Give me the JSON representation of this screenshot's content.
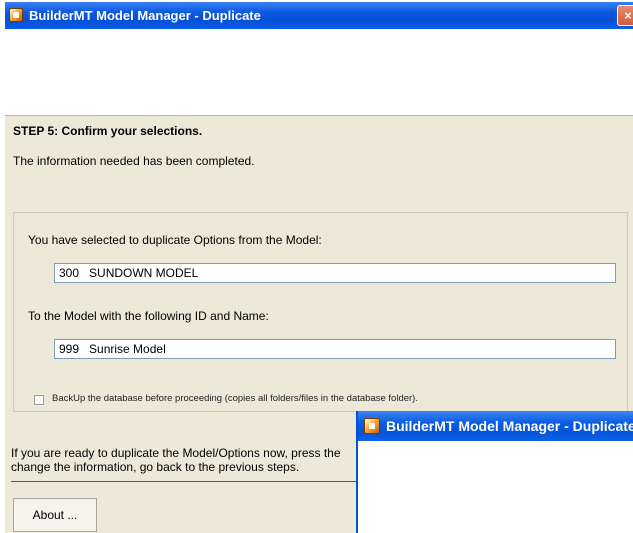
{
  "window": {
    "title": "BuilderMT Model Manager - Duplicate",
    "close_icon": "×"
  },
  "step": {
    "title": "STEP 5: Confirm your selections.",
    "info": "The information needed has been completed."
  },
  "group": {
    "source_label": "You have selected to duplicate Options from the Model:",
    "source_value": "300   SUNDOWN MODEL",
    "target_label": "To the Model with the following ID and Name:",
    "target_value": "999   Sunrise Model",
    "backup_label": "BackUp the database before proceeding (copies all folders/files in the database folder).",
    "backup_checked": false
  },
  "bottom": {
    "line1": "If you are ready to duplicate the Model/Options now, press the",
    "line2": "change the information, go back to the previous steps.",
    "about_label": "About ..."
  },
  "window2": {
    "title": "BuilderMT Model Manager - Duplicate"
  }
}
